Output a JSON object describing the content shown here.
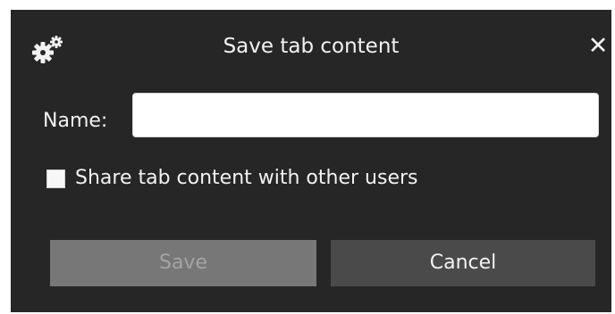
{
  "dialog": {
    "title": "Save tab content",
    "title_icon": "gear-icon",
    "close_icon": "close-icon",
    "close_glyph": "✕"
  },
  "form": {
    "name_label": "Name:",
    "name_value": "",
    "share_label": "Share tab content with other users",
    "share_checked": false
  },
  "buttons": {
    "save_label": "Save",
    "save_enabled": false,
    "cancel_label": "Cancel"
  },
  "colors": {
    "dialog_background": "#262626",
    "text": "#f2f2f2",
    "save_disabled": "#777777",
    "cancel_background": "#4a4a4a"
  }
}
